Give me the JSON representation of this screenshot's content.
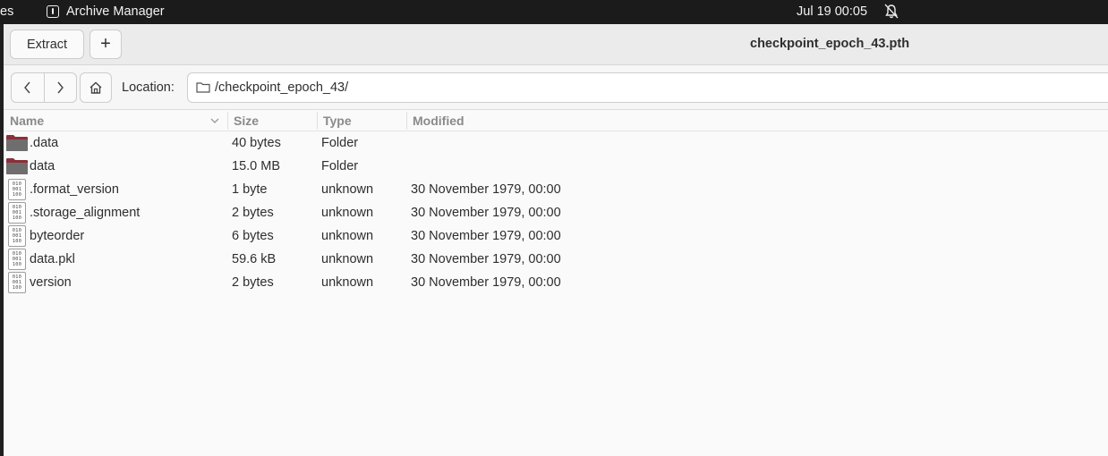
{
  "system_bar": {
    "activities_label": "es",
    "app_name": "Archive Manager",
    "clock": "Jul 19  00:05"
  },
  "header": {
    "extract_label": "Extract",
    "add_label": "+",
    "title": "checkpoint_epoch_43.pth"
  },
  "location": {
    "label": "Location:",
    "path": "/checkpoint_epoch_43/"
  },
  "columns": {
    "name": "Name",
    "size": "Size",
    "type": "Type",
    "modified": "Modified"
  },
  "files": [
    {
      "name": ".data",
      "size": "40 bytes",
      "type": "Folder",
      "modified": "",
      "icon": "folder-icon"
    },
    {
      "name": "data",
      "size": "15.0 MB",
      "type": "Folder",
      "modified": "",
      "icon": "folder-icon"
    },
    {
      "name": ".format_version",
      "size": "1 byte",
      "type": "unknown",
      "modified": "30 November 1979, 00:00",
      "icon": "binary-file-icon"
    },
    {
      "name": ".storage_alignment",
      "size": "2 bytes",
      "type": "unknown",
      "modified": "30 November 1979, 00:00",
      "icon": "binary-file-icon"
    },
    {
      "name": "byteorder",
      "size": "6 bytes",
      "type": "unknown",
      "modified": "30 November 1979, 00:00",
      "icon": "binary-file-icon"
    },
    {
      "name": "data.pkl",
      "size": "59.6 kB",
      "type": "unknown",
      "modified": "30 November 1979, 00:00",
      "icon": "binary-file-icon"
    },
    {
      "name": "version",
      "size": "2 bytes",
      "type": "unknown",
      "modified": "30 November 1979, 00:00",
      "icon": "binary-file-icon"
    }
  ],
  "colors": {
    "folder": "#8c2f3a",
    "folder_body": "#6e6e6e",
    "topbar": "#1b1b1b"
  }
}
